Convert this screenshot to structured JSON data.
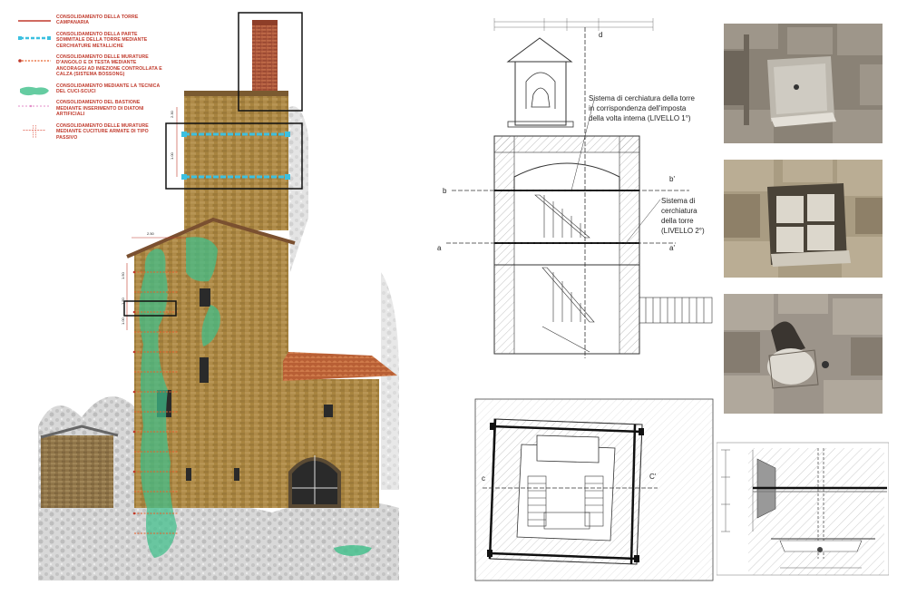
{
  "legend": {
    "items": [
      {
        "text": "CONSOLIDAMENTO DELLA TORRE CAMPANARIA"
      },
      {
        "text": "CONSOLIDAMENTO DELLA PARTE SOMMITALE DELLA TORRE MEDIANTE CERCHIATURE METALLICHE"
      },
      {
        "text": "CONSOLIDAMENTO DELLE MURATURE D'ANGOLO E DI TESTA MEDIANTE ANCORAGGI AD INIEZIONE CONTROLLATA E CALZA (SISTEMA BOSSONG)"
      },
      {
        "text": "CONSOLIDAMENTO MEDIANTE LA TECNICA DEL CUCI-SCUCI"
      },
      {
        "text": "CONSOLIDAMENTO DEL BASTIONE MEDIANTE INSERIMENTO DI DIATONI ARTIFICIALI"
      },
      {
        "text": "CONSOLIDAMENTO DELLE MURATURE MEDIANTE CUCITURE ARMATE DI TIPO PASSIVO"
      }
    ]
  },
  "elevation": {
    "dims": [
      "2.30",
      "1.00",
      "2.50",
      "1.50",
      "1.50",
      "1.00"
    ]
  },
  "section": {
    "label_d": "d",
    "label_b": "b",
    "label_b2": "b'",
    "label_a": "a",
    "label_a2": "a'",
    "note1": [
      "Sistema di cerchiatura della torre",
      "in corrispondenza dell'imposta",
      "della volta interna (LIVELLO 1°)"
    ],
    "note2": [
      "Sistema di",
      "cerchiatura",
      "della torre",
      "(LIVELLO 2°)"
    ]
  },
  "plan": {
    "label_c": "c",
    "label_c2": "C'"
  },
  "colors": {
    "red": "#c0392b",
    "cyan": "#3cc0e0",
    "green": "#3fbf8a",
    "stone": "#b08a4a",
    "roof": "#c0683a"
  }
}
